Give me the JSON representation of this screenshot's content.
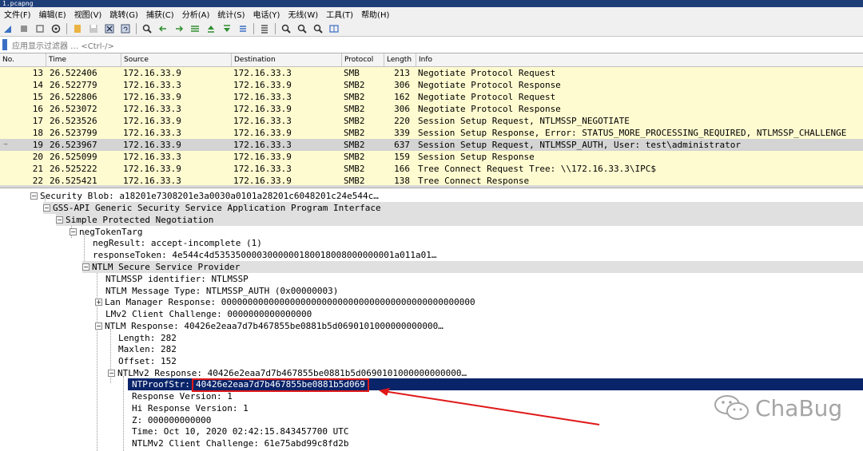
{
  "window": {
    "title": "1.pcapng"
  },
  "menu": [
    "文件(F)",
    "编辑(E)",
    "视图(V)",
    "跳转(G)",
    "捕获(C)",
    "分析(A)",
    "统计(S)",
    "电话(Y)",
    "无线(W)",
    "工具(T)",
    "帮助(H)"
  ],
  "filter": {
    "placeholder": "应用显示过滤器 … <Ctrl-/>"
  },
  "columns": [
    "No.",
    "Time",
    "Source",
    "Destination",
    "Protocol",
    "Length",
    "Info"
  ],
  "packets": [
    {
      "no": "13",
      "time": "26.522406",
      "src": "172.16.33.9",
      "dst": "172.16.33.3",
      "proto": "SMB",
      "len": "213",
      "info": "Negotiate Protocol Request"
    },
    {
      "no": "14",
      "time": "26.522779",
      "src": "172.16.33.3",
      "dst": "172.16.33.9",
      "proto": "SMB2",
      "len": "306",
      "info": "Negotiate Protocol Response"
    },
    {
      "no": "15",
      "time": "26.522806",
      "src": "172.16.33.9",
      "dst": "172.16.33.3",
      "proto": "SMB2",
      "len": "162",
      "info": "Negotiate Protocol Request"
    },
    {
      "no": "16",
      "time": "26.523072",
      "src": "172.16.33.3",
      "dst": "172.16.33.9",
      "proto": "SMB2",
      "len": "306",
      "info": "Negotiate Protocol Response"
    },
    {
      "no": "17",
      "time": "26.523526",
      "src": "172.16.33.9",
      "dst": "172.16.33.3",
      "proto": "SMB2",
      "len": "220",
      "info": "Session Setup Request, NTLMSSP_NEGOTIATE"
    },
    {
      "no": "18",
      "time": "26.523799",
      "src": "172.16.33.3",
      "dst": "172.16.33.9",
      "proto": "SMB2",
      "len": "339",
      "info": "Session Setup Response, Error: STATUS_MORE_PROCESSING_REQUIRED, NTLMSSP_CHALLENGE"
    },
    {
      "no": "19",
      "time": "26.523967",
      "src": "172.16.33.9",
      "dst": "172.16.33.3",
      "proto": "SMB2",
      "len": "637",
      "info": "Session Setup Request, NTLMSSP_AUTH, User: test\\administrator"
    },
    {
      "no": "20",
      "time": "26.525099",
      "src": "172.16.33.3",
      "dst": "172.16.33.9",
      "proto": "SMB2",
      "len": "159",
      "info": "Session Setup Response"
    },
    {
      "no": "21",
      "time": "26.525222",
      "src": "172.16.33.9",
      "dst": "172.16.33.3",
      "proto": "SMB2",
      "len": "166",
      "info": "Tree Connect Request Tree: \\\\172.16.33.3\\IPC$"
    },
    {
      "no": "22",
      "time": "26.525421",
      "src": "172.16.33.3",
      "dst": "172.16.33.9",
      "proto": "SMB2",
      "len": "138",
      "info": "Tree Connect Response"
    }
  ],
  "tree": [
    "Security Blob: a18201e7308201e3a0030a0101a28201c6048201c24e544c…",
    "GSS-API Generic Security Service Application Program Interface",
    "Simple Protected Negotiation",
    "negTokenTarg",
    "negResult: accept-incomplete (1)",
    "responseToken: 4e544c4d5353500003000000180018008000000001a011a01…",
    "NTLM Secure Service Provider",
    "NTLMSSP identifier: NTLMSSP",
    "NTLM Message Type: NTLMSSP_AUTH (0x00000003)",
    "Lan Manager Response: 000000000000000000000000000000000000000000000000",
    "LMv2 Client Challenge: 0000000000000000",
    "NTLM Response: 40426e2eaa7d7b467855be0881b5d0690101000000000000…",
    "Length: 282",
    "Maxlen: 282",
    "Offset: 152",
    "NTLMv2 Response: 40426e2eaa7d7b467855be0881b5d0690101000000000000…",
    "NTProofStr: ",
    "40426e2eaa7d7b467855be0881b5d069",
    "Response Version: 1",
    "Hi Response Version: 1",
    "Z: 000000000000",
    "Time: Oct 10, 2020 02:42:15.843457700 UTC",
    "NTLMv2 Client Challenge: 61e75abd99c8fd2b"
  ],
  "watermark": "ChaBug",
  "colors": {
    "packet_bg": "#fffbd0",
    "selected_bg": "#0a246a",
    "annotation": "#e01818"
  }
}
